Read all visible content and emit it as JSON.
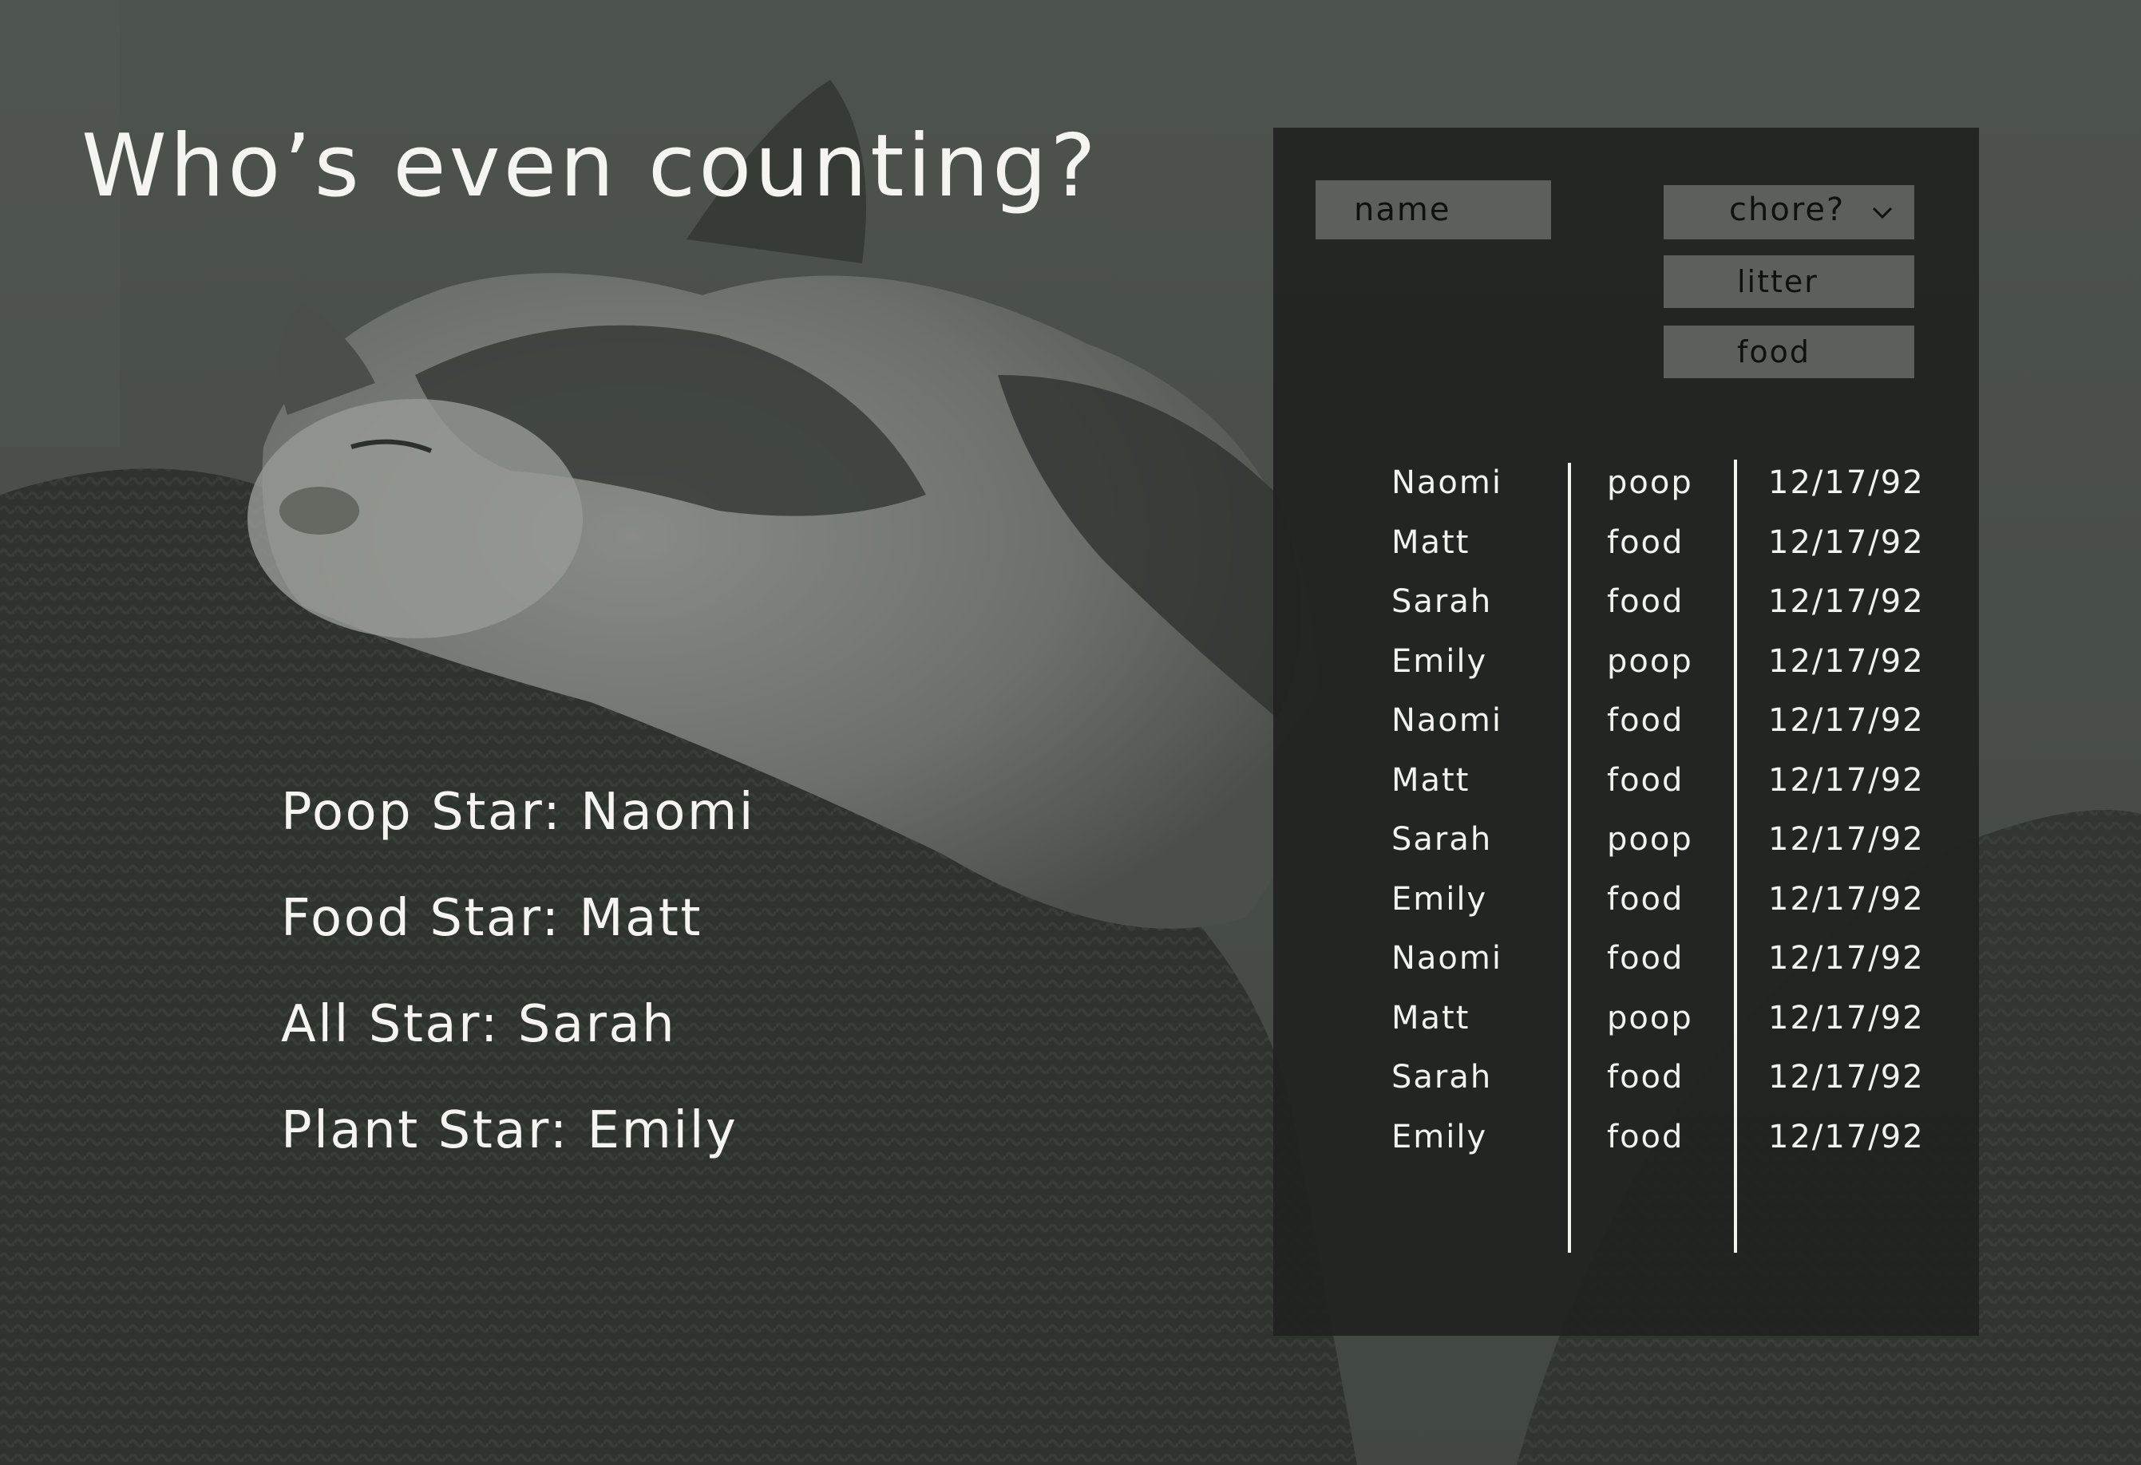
{
  "title": "Who’s even counting?",
  "stars": [
    {
      "label": "Poop Star: Naomi"
    },
    {
      "label": "Food Star: Matt"
    },
    {
      "label": "All Star: Sarah"
    },
    {
      "label": "Plant Star: Emily"
    }
  ],
  "form": {
    "name_placeholder": "name",
    "chore_select_label": "chore?",
    "chore_options": [
      "litter",
      "food"
    ]
  },
  "log": [
    {
      "name": "Naomi",
      "chore": "poop",
      "date": "12/17/92"
    },
    {
      "name": "Matt",
      "chore": "food",
      "date": "12/17/92"
    },
    {
      "name": "Sarah",
      "chore": "food",
      "date": "12/17/92"
    },
    {
      "name": "Emily",
      "chore": "poop",
      "date": "12/17/92"
    },
    {
      "name": "Naomi",
      "chore": "food",
      "date": "12/17/92"
    },
    {
      "name": "Matt",
      "chore": "food",
      "date": "12/17/92"
    },
    {
      "name": "Sarah",
      "chore": "poop",
      "date": "12/17/92"
    },
    {
      "name": "Emily",
      "chore": "food",
      "date": "12/17/92"
    },
    {
      "name": "Naomi",
      "chore": "food",
      "date": "12/17/92"
    },
    {
      "name": "Matt",
      "chore": "poop",
      "date": "12/17/92"
    },
    {
      "name": "Sarah",
      "chore": "food",
      "date": "12/17/92"
    },
    {
      "name": "Emily",
      "chore": "food",
      "date": "12/17/92"
    }
  ],
  "icons": {
    "chore_select": "chevron-down-icon",
    "background": "sleeping-cat-photo"
  },
  "colors": {
    "panel": "#202220",
    "field": "#5c5f5c",
    "text": "#f4f5ef",
    "field_text": "#0f100f"
  }
}
